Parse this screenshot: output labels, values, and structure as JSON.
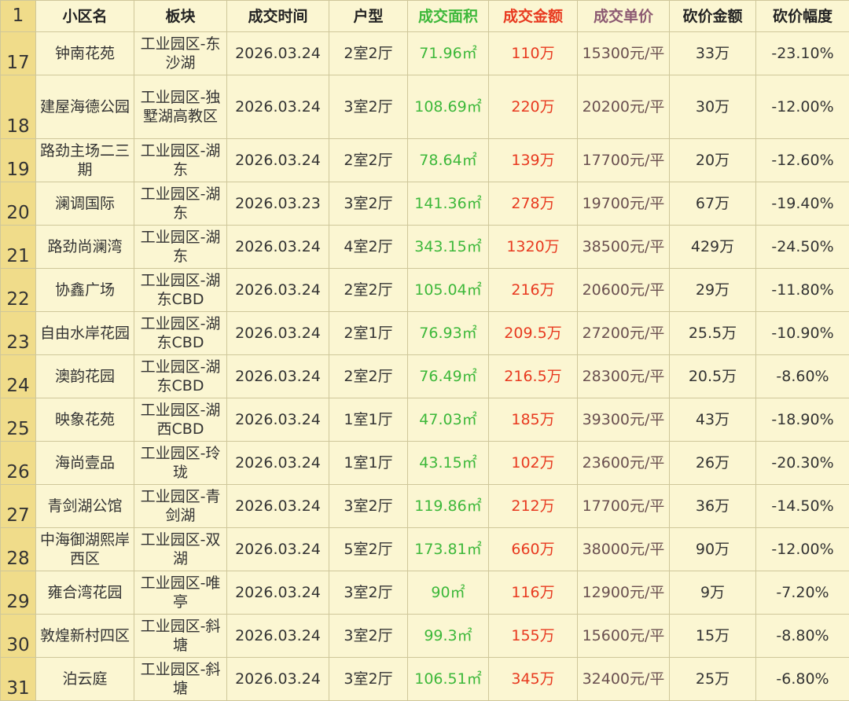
{
  "colors": {
    "background": "#fbf6d2",
    "row_header_bg": "#f0dc8a",
    "area_green": "#3db83a",
    "amount_red": "#e8391f",
    "unit_price": "#6a5050",
    "grid": "#cfc79a"
  },
  "header": {
    "rownum": "1",
    "name": "小区名",
    "block": "板块",
    "date": "成交时间",
    "layout": "户型",
    "area": "成交面积",
    "amount": "成交金额",
    "unit_price": "成交单价",
    "cut_amount": "砍价金额",
    "cut_rate": "砍价幅度"
  },
  "rows": [
    {
      "num": "17",
      "name": "钟南花苑",
      "block": "工业园区-东沙湖",
      "date": "2026.03.24",
      "layout": "2室2厅",
      "area": "71.96㎡",
      "amount": "110万",
      "unit_price": "15300元/平",
      "cut_amount": "33万",
      "cut_rate": "-23.10%"
    },
    {
      "num": "18",
      "name": "建屋海德公园",
      "block": "工业园区-独墅湖高教区",
      "date": "2026.03.24",
      "layout": "3室2厅",
      "area": "108.69㎡",
      "amount": "220万",
      "unit_price": "20200元/平",
      "cut_amount": "30万",
      "cut_rate": "-12.00%"
    },
    {
      "num": "19",
      "name": "路劲主场二三期",
      "block": "工业园区-湖东",
      "date": "2026.03.24",
      "layout": "2室2厅",
      "area": "78.64㎡",
      "amount": "139万",
      "unit_price": "17700元/平",
      "cut_amount": "20万",
      "cut_rate": "-12.60%"
    },
    {
      "num": "20",
      "name": "澜调国际",
      "block": "工业园区-湖东",
      "date": "2026.03.23",
      "layout": "3室2厅",
      "area": "141.36㎡",
      "amount": "278万",
      "unit_price": "19700元/平",
      "cut_amount": "67万",
      "cut_rate": "-19.40%"
    },
    {
      "num": "21",
      "name": "路劲尚澜湾",
      "block": "工业园区-湖东",
      "date": "2026.03.24",
      "layout": "4室2厅",
      "area": "343.15㎡",
      "amount": "1320万",
      "unit_price": "38500元/平",
      "cut_amount": "429万",
      "cut_rate": "-24.50%"
    },
    {
      "num": "22",
      "name": "协鑫广场",
      "block": "工业园区-湖东CBD",
      "date": "2026.03.24",
      "layout": "2室2厅",
      "area": "105.04㎡",
      "amount": "216万",
      "unit_price": "20600元/平",
      "cut_amount": "29万",
      "cut_rate": "-11.80%"
    },
    {
      "num": "23",
      "name": "自由水岸花园",
      "block": "工业园区-湖东CBD",
      "date": "2026.03.24",
      "layout": "2室1厅",
      "area": "76.93㎡",
      "amount": "209.5万",
      "unit_price": "27200元/平",
      "cut_amount": "25.5万",
      "cut_rate": "-10.90%"
    },
    {
      "num": "24",
      "name": "澳韵花园",
      "block": "工业园区-湖东CBD",
      "date": "2026.03.24",
      "layout": "2室2厅",
      "area": "76.49㎡",
      "amount": "216.5万",
      "unit_price": "28300元/平",
      "cut_amount": "20.5万",
      "cut_rate": "-8.60%"
    },
    {
      "num": "25",
      "name": "映象花苑",
      "block": "工业园区-湖西CBD",
      "date": "2026.03.24",
      "layout": "1室1厅",
      "area": "47.03㎡",
      "amount": "185万",
      "unit_price": "39300元/平",
      "cut_amount": "43万",
      "cut_rate": "-18.90%"
    },
    {
      "num": "26",
      "name": "海尚壹品",
      "block": "工业园区-玲珑",
      "date": "2026.03.24",
      "layout": "1室1厅",
      "area": "43.15㎡",
      "amount": "102万",
      "unit_price": "23600元/平",
      "cut_amount": "26万",
      "cut_rate": "-20.30%"
    },
    {
      "num": "27",
      "name": "青剑湖公馆",
      "block": "工业园区-青剑湖",
      "date": "2026.03.24",
      "layout": "3室2厅",
      "area": "119.86㎡",
      "amount": "212万",
      "unit_price": "17700元/平",
      "cut_amount": "36万",
      "cut_rate": "-14.50%"
    },
    {
      "num": "28",
      "name": "中海御湖熙岸西区",
      "block": "工业园区-双湖",
      "date": "2026.03.24",
      "layout": "5室2厅",
      "area": "173.81㎡",
      "amount": "660万",
      "unit_price": "38000元/平",
      "cut_amount": "90万",
      "cut_rate": "-12.00%"
    },
    {
      "num": "29",
      "name": "雍合湾花园",
      "block": "工业园区-唯亭",
      "date": "2026.03.24",
      "layout": "3室2厅",
      "area": "90㎡",
      "amount": "116万",
      "unit_price": "12900元/平",
      "cut_amount": "9万",
      "cut_rate": "-7.20%"
    },
    {
      "num": "30",
      "name": "敦煌新村四区",
      "block": "工业园区-斜塘",
      "date": "2026.03.24",
      "layout": "3室2厅",
      "area": "99.3㎡",
      "amount": "155万",
      "unit_price": "15600元/平",
      "cut_amount": "15万",
      "cut_rate": "-8.80%"
    },
    {
      "num": "31",
      "name": "泊云庭",
      "block": "工业园区-斜塘",
      "date": "2026.03.24",
      "layout": "3室2厅",
      "area": "106.51㎡",
      "amount": "345万",
      "unit_price": "32400元/平",
      "cut_amount": "25万",
      "cut_rate": "-6.80%"
    }
  ]
}
